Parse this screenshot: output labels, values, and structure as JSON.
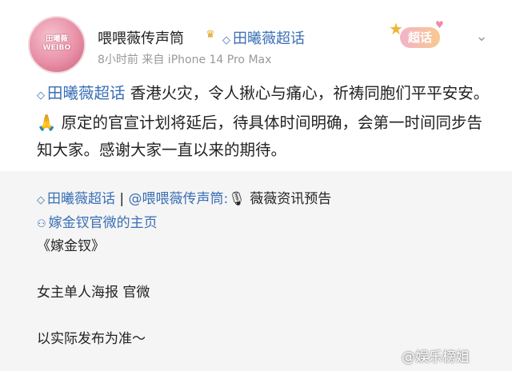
{
  "post": {
    "avatar_text": "田曦薇 WEIBO",
    "username": "喂喂薇传声筒",
    "vip_icon": "crown-icon",
    "topic_link": "田曦薇超话",
    "meta": "8小时前  来自 iPhone 14 Pro Max",
    "stamp_label": "超话",
    "content": {
      "topic": "田曦薇超话",
      "text": " 香港火灾，令人揪心与痛心，祈祷同胞们平平安安。🙏 原定的官宣计划将延后，待具体时间明确，会第一时间同步告知大家。感谢大家一直以来的期待。"
    }
  },
  "repost": {
    "topic": "田曦薇超话",
    "separator": " | ",
    "mention": "@喂喂薇传声筒:",
    "mic_icon": "🎙",
    "announce": " 薇薇资讯预告",
    "profile_link": "嫁金钗官微的主页",
    "body": "《嫁金钗》\n\n女主单人海报 官微\n\n以实际发布为准～"
  },
  "watermark": "@娱乐榜姐"
}
